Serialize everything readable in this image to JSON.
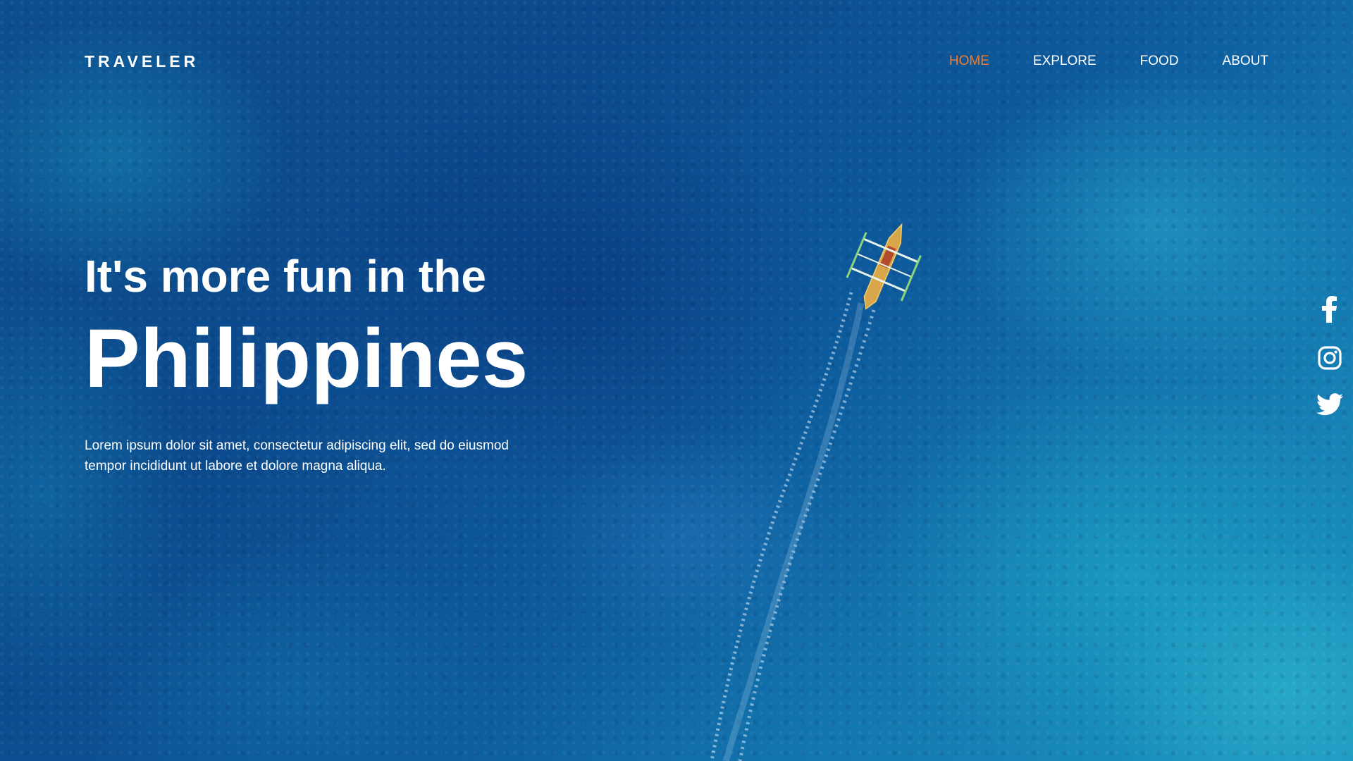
{
  "brand": {
    "logo_text": "TRAVELER"
  },
  "nav": {
    "items": [
      {
        "label": "HOME",
        "active": true
      },
      {
        "label": "EXPLORE",
        "active": false
      },
      {
        "label": "FOOD",
        "active": false
      },
      {
        "label": "ABOUT",
        "active": false
      }
    ],
    "active_color": "#f07b2c"
  },
  "hero": {
    "headline": "It's more fun in the",
    "destination": "Philippines",
    "description": "Lorem ipsum dolor sit amet, consectetur adipiscing elit, sed do eiusmod tempor incididunt ut labore et dolore magna aliqua."
  },
  "social": {
    "icons": [
      "facebook-icon",
      "instagram-icon",
      "twitter-icon"
    ]
  },
  "colors": {
    "text": "#ffffff",
    "accent": "#f07b2c",
    "ocean_dark": "#0b4a8c",
    "ocean_light": "#1a94bf"
  }
}
